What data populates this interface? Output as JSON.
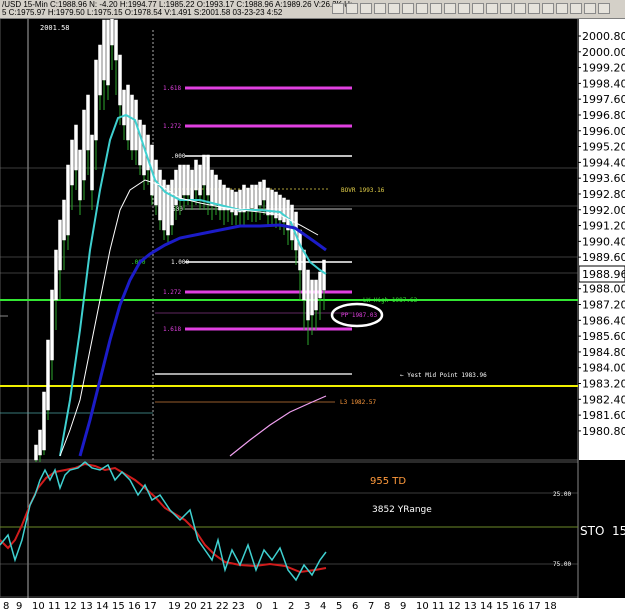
{
  "window": {
    "title": "/USD 15-Min  C:1988.96  N: -4.20  H:1994.77  L:1985.22  O:1993.17  C:1988.96  A:1989.26  V:26.2K  U:",
    "ohlc": "5  C:1975.97  H:1979.50  L:1975.15  O:1978.54  V:1.491  S:2001.58  03-23-23  4:52"
  },
  "colors": {
    "background": "#000000",
    "price": "#ffffff",
    "ema_fast": "#3fd0d0",
    "ema_slow": "#1c1cc8",
    "fib": "#e040e0",
    "pivot": "#e6d34a",
    "lw_high": "#33e633",
    "yest_mid": "#f0f000",
    "stoch_k": "#3fd0d0",
    "stoch_d": "#d01c1c",
    "td_text": "#ff9a3c"
  },
  "chart": {
    "type": "candlestick",
    "high_marker": "2001.58",
    "last_price": "1988.96",
    "price_axis_labels": [
      "2000.80",
      "2000.00",
      "1999.20",
      "1998.40",
      "1997.60",
      "1996.80",
      "1996.00",
      "1995.20",
      "1994.40",
      "1993.60",
      "1992.80",
      "1992.00",
      "1991.20",
      "1990.40",
      "1989.60",
      "1988.00",
      "1987.20",
      "1986.40",
      "1985.60",
      "1984.80",
      "1984.00",
      "1983.20",
      "1982.40",
      "1981.60",
      "1980.80"
    ],
    "levels": {
      "fib_upper_1": "1.618",
      "fib_upper_2": "1.272",
      "fib_0_upper": ".000",
      "fib_1_000": "1.000",
      "fib_lower_1": "1.272",
      "fib_lower_2": "1.618",
      "fib_mid_000": ".000",
      "fib_500": "500",
      "bovr": "BOVR 1993.16",
      "lw_high": "LW High 1987.63",
      "pp": "PP 1987.03",
      "yest_mid": "Yest Mid Point 1983.96",
      "l3": "L3 1982.57"
    },
    "time_axis_labels": [
      "8",
      "9",
      "10",
      "11",
      "12",
      "13",
      "14",
      "15",
      "16",
      "17",
      "19",
      "20",
      "21",
      "22",
      "23",
      "0",
      "1",
      "2",
      "3",
      "4",
      "5",
      "6",
      "7",
      "8",
      "9",
      "10",
      "11",
      "12",
      "13",
      "14",
      "15",
      "16",
      "17",
      "18"
    ]
  },
  "indicator": {
    "td_text": "955 TD",
    "yrange_text": "3852 YRange",
    "label": "STO",
    "period": "15",
    "level_high": "25.00",
    "level_low": "75.00"
  }
}
